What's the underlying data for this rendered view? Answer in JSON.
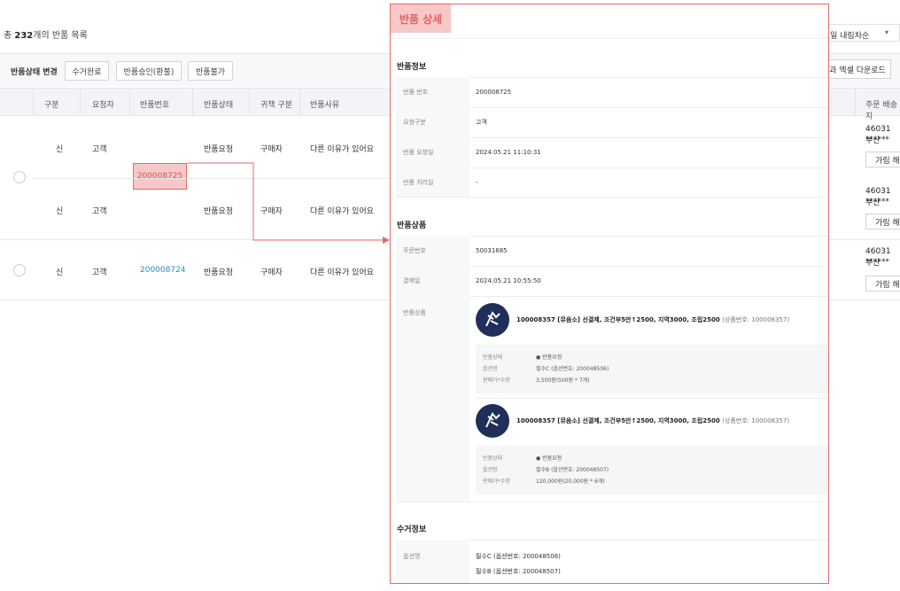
{
  "list": {
    "total_prefix": "총 ",
    "total_count": "232",
    "total_suffix": "개의 반품 목록",
    "toolbar_label": "반품상태 변경",
    "buttons": [
      "수거완료",
      "반품승인(환불)",
      "반품불가"
    ],
    "headers": [
      "구분",
      "요청자",
      "반품번호",
      "반품상태",
      "귀책 구분",
      "반품사유"
    ],
    "rows": [
      {
        "gubun": "신",
        "requester": "고객",
        "status": "반품요청",
        "fault": "구매자",
        "reason": "다른 이유가 있어요"
      },
      {
        "gubun": "신",
        "requester": "고객",
        "status": "반품요청",
        "fault": "구매자",
        "reason": "다른 이유가 있어요"
      },
      {
        "gubun": "신",
        "requester": "고객",
        "return_no": "200008724",
        "status": "반품요청",
        "fault": "구매자",
        "reason": "다른 이유가 있어요"
      }
    ],
    "merged_return_no": "200008725"
  },
  "right": {
    "sort_label": "일 내림차순",
    "download_label": "과 엑셀 다운로드",
    "column_header": "주문 배송지",
    "cells": [
      {
        "addr": "46031 부산",
        "mask": "******",
        "btn": "가림 해"
      },
      {
        "addr": "46031 부산",
        "mask": "******",
        "btn": "가림 해"
      },
      {
        "addr": "46031 부산",
        "mask": "******",
        "btn": "가림 해"
      }
    ]
  },
  "detail": {
    "title": "반품 상세",
    "section_return_info": "반품정보",
    "return_info": [
      {
        "k": "반품 번호",
        "v": "200008725"
      },
      {
        "k": "요청구분",
        "v": "고객"
      },
      {
        "k": "반품 요청일",
        "v": "2024.05.21 11:10:31"
      },
      {
        "k": "반품 처리일",
        "v": "-"
      }
    ],
    "section_products": "반품상품",
    "order_info": [
      {
        "k": "주문번호",
        "v": "50031685"
      },
      {
        "k": "결제일",
        "v": "2024.05.21 10:55:50"
      }
    ],
    "products_label": "반품상품",
    "products": [
      {
        "name": "100008357 [뮤음소] 선결제, 조건부5만↑2500, 지역3000, 조립2500",
        "product_no": "(상품번호: 100008357)",
        "rows": [
          {
            "k": "반품상태",
            "v": "● 반품요청"
          },
          {
            "k": "옵션명",
            "v": "필수C (옵션번호: 200048506)"
          },
          {
            "k": "판매가*수량",
            "v": "3,500원(500원 * 7개)"
          }
        ]
      },
      {
        "name": "100008357 [뮤음소] 선결제, 조건부5만↑2500, 지역3000, 조립2500",
        "product_no": "(상품번호: 100008357)",
        "rows": [
          {
            "k": "반품상태",
            "v": "● 반품요청"
          },
          {
            "k": "옵션명",
            "v": "필수B (옵션번호: 200048507)"
          },
          {
            "k": "판매가*수량",
            "v": "120,000원(20,000원 * 6개)"
          }
        ]
      }
    ],
    "section_pickup": "수거정보",
    "pickup_label": "옵션명",
    "pickup_lines": [
      "필수C (옵션번호: 200048506)",
      "필수B (옵션번호: 200048507)"
    ]
  },
  "colors": {
    "highlight_fill": "#f8c8c8",
    "highlight_border": "#e36b6b",
    "link": "#2a8ccc",
    "logo": "#1f2f5a"
  }
}
